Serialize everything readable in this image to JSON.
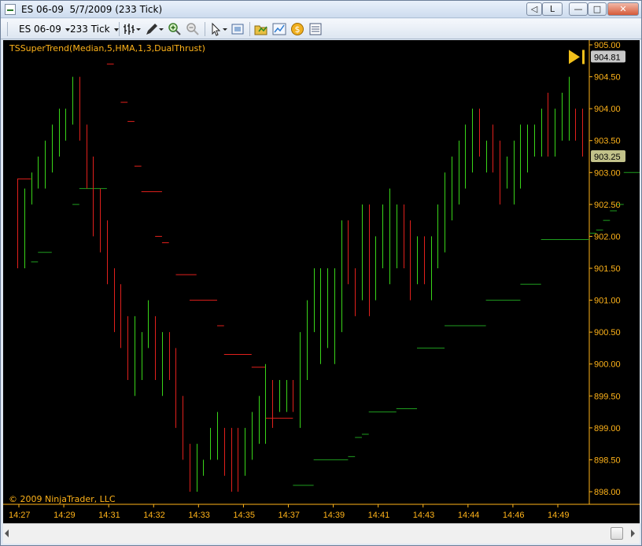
{
  "window": {
    "title": "ES 06-09  5/7/2009 (233 Tick)",
    "controls": {
      "link_label": "L",
      "minimize": "—",
      "maximize": "□",
      "close": "✕"
    }
  },
  "toolbar": {
    "instrument": "ES 06-09",
    "period": "233 Tick",
    "icons": [
      "bar-type-icon",
      "drawing-pen-icon",
      "zoom-in-icon",
      "zoom-out-icon",
      "cursor-pointer-icon",
      "snapshot-icon",
      "instrument-folder-icon",
      "chart-indicators-icon",
      "strategy-coin-icon",
      "data-box-icon"
    ]
  },
  "chart": {
    "indicator_label": "TSSuperTrend(Median,5,HMA,1,3,DualThrust)",
    "copyright": "© 2009 NinjaTrader, LLC",
    "last_price": "904.81",
    "stop_price": "903.25",
    "colors": {
      "up": "#39d619",
      "down": "#e2201c",
      "supertrend": "#1f9e1f",
      "axis": "#ffb319",
      "background": "#000000"
    }
  },
  "chart_data": {
    "type": "ohlc",
    "yticks": [
      "905.00",
      "904.50",
      "904.00",
      "903.50",
      "903.00",
      "902.50",
      "902.00",
      "901.50",
      "901.00",
      "900.50",
      "900.00",
      "899.50",
      "899.00",
      "898.50",
      "898.00"
    ],
    "ylim": [
      898.0,
      905.0
    ],
    "xticks": [
      "14:27",
      "14:29",
      "14:31",
      "14:32",
      "14:33",
      "14:35",
      "14:37",
      "14:39",
      "14:41",
      "14:43",
      "14:44",
      "14:46",
      "14:49"
    ],
    "bars": [
      {
        "dir": "down",
        "h": 902.9,
        "l": 901.5
      },
      {
        "dir": "up",
        "h": 902.75,
        "l": 901.5
      },
      {
        "dir": "up",
        "h": 903.0,
        "l": 902.5
      },
      {
        "dir": "up",
        "h": 903.25,
        "l": 902.75
      },
      {
        "dir": "up",
        "h": 903.5,
        "l": 902.75
      },
      {
        "dir": "up",
        "h": 903.75,
        "l": 903.0
      },
      {
        "dir": "up",
        "h": 904.0,
        "l": 903.25
      },
      {
        "dir": "up",
        "h": 904.0,
        "l": 903.5
      },
      {
        "dir": "up",
        "h": 904.5,
        "l": 903.75
      },
      {
        "dir": "down",
        "h": 904.5,
        "l": 903.5
      },
      {
        "dir": "down",
        "h": 903.75,
        "l": 902.75
      },
      {
        "dir": "down",
        "h": 903.25,
        "l": 902.0
      },
      {
        "dir": "down",
        "h": 902.75,
        "l": 901.75
      },
      {
        "dir": "down",
        "h": 902.25,
        "l": 901.25
      },
      {
        "dir": "down",
        "h": 901.5,
        "l": 900.5
      },
      {
        "dir": "down",
        "h": 901.25,
        "l": 900.25
      },
      {
        "dir": "down",
        "h": 900.75,
        "l": 899.75
      },
      {
        "dir": "up",
        "h": 900.75,
        "l": 899.5
      },
      {
        "dir": "up",
        "h": 900.5,
        "l": 899.75
      },
      {
        "dir": "up",
        "h": 901.0,
        "l": 900.25
      },
      {
        "dir": "down",
        "h": 900.75,
        "l": 899.75
      },
      {
        "dir": "up",
        "h": 900.5,
        "l": 899.5
      },
      {
        "dir": "down",
        "h": 900.5,
        "l": 899.75
      },
      {
        "dir": "down",
        "h": 900.25,
        "l": 899.0
      },
      {
        "dir": "down",
        "h": 899.5,
        "l": 898.5
      },
      {
        "dir": "down",
        "h": 898.75,
        "l": 898.0
      },
      {
        "dir": "up",
        "h": 898.75,
        "l": 898.0
      },
      {
        "dir": "up",
        "h": 898.5,
        "l": 898.25
      },
      {
        "dir": "up",
        "h": 899.0,
        "l": 898.5
      },
      {
        "dir": "up",
        "h": 899.25,
        "l": 898.5
      },
      {
        "dir": "down",
        "h": 899.0,
        "l": 898.25
      },
      {
        "dir": "down",
        "h": 899.0,
        "l": 898.0
      },
      {
        "dir": "down",
        "h": 899.0,
        "l": 898.0
      },
      {
        "dir": "up",
        "h": 899.0,
        "l": 898.25
      },
      {
        "dir": "up",
        "h": 899.25,
        "l": 898.5
      },
      {
        "dir": "up",
        "h": 899.5,
        "l": 898.75
      },
      {
        "dir": "up",
        "h": 900.0,
        "l": 898.75
      },
      {
        "dir": "down",
        "h": 899.75,
        "l": 899.0
      },
      {
        "dir": "up",
        "h": 899.75,
        "l": 899.25
      },
      {
        "dir": "up",
        "h": 899.75,
        "l": 899.25
      },
      {
        "dir": "down",
        "h": 899.75,
        "l": 899.25
      },
      {
        "dir": "up",
        "h": 900.5,
        "l": 899.0
      },
      {
        "dir": "up",
        "h": 901.0,
        "l": 899.75
      },
      {
        "dir": "up",
        "h": 901.5,
        "l": 900.5
      },
      {
        "dir": "up",
        "h": 901.5,
        "l": 900.0
      },
      {
        "dir": "up",
        "h": 901.5,
        "l": 900.25
      },
      {
        "dir": "up",
        "h": 901.5,
        "l": 900.0
      },
      {
        "dir": "up",
        "h": 902.25,
        "l": 900.5
      },
      {
        "dir": "down",
        "h": 902.25,
        "l": 901.25
      },
      {
        "dir": "down",
        "h": 901.5,
        "l": 900.75
      },
      {
        "dir": "up",
        "h": 902.5,
        "l": 901.0
      },
      {
        "dir": "down",
        "h": 902.5,
        "l": 900.75
      },
      {
        "dir": "up",
        "h": 902.0,
        "l": 901.0
      },
      {
        "dir": "up",
        "h": 902.5,
        "l": 901.5
      },
      {
        "dir": "up",
        "h": 902.75,
        "l": 901.25
      },
      {
        "dir": "up",
        "h": 902.5,
        "l": 901.5
      },
      {
        "dir": "down",
        "h": 902.5,
        "l": 901.5
      },
      {
        "dir": "down",
        "h": 902.25,
        "l": 901.0
      },
      {
        "dir": "up",
        "h": 902.0,
        "l": 901.25
      },
      {
        "dir": "down",
        "h": 902.0,
        "l": 901.25
      },
      {
        "dir": "up",
        "h": 902.0,
        "l": 901.0
      },
      {
        "dir": "up",
        "h": 902.5,
        "l": 901.5
      },
      {
        "dir": "up",
        "h": 903.0,
        "l": 901.75
      },
      {
        "dir": "up",
        "h": 903.25,
        "l": 902.25
      },
      {
        "dir": "up",
        "h": 903.5,
        "l": 902.5
      },
      {
        "dir": "up",
        "h": 903.75,
        "l": 902.75
      },
      {
        "dir": "up",
        "h": 904.0,
        "l": 903.0
      },
      {
        "dir": "down",
        "h": 904.0,
        "l": 903.25
      },
      {
        "dir": "up",
        "h": 903.5,
        "l": 903.0
      },
      {
        "dir": "down",
        "h": 903.75,
        "l": 903.0
      },
      {
        "dir": "down",
        "h": 903.5,
        "l": 902.5
      },
      {
        "dir": "up",
        "h": 903.25,
        "l": 902.75
      },
      {
        "dir": "up",
        "h": 903.5,
        "l": 902.5
      },
      {
        "dir": "up",
        "h": 903.75,
        "l": 902.75
      },
      {
        "dir": "up",
        "h": 903.75,
        "l": 903.0
      },
      {
        "dir": "up",
        "h": 903.75,
        "l": 903.25
      },
      {
        "dir": "up",
        "h": 904.0,
        "l": 903.25
      },
      {
        "dir": "down",
        "h": 904.25,
        "l": 903.25
      },
      {
        "dir": "up",
        "h": 904.0,
        "l": 903.25
      },
      {
        "dir": "up",
        "h": 904.25,
        "l": 903.5
      },
      {
        "dir": "up",
        "h": 904.5,
        "l": 903.5
      },
      {
        "dir": "down",
        "h": 904.0,
        "l": 903.5
      },
      {
        "dir": "down",
        "h": 904.0,
        "l": 903.25
      }
    ],
    "supertrend": [
      {
        "from": 0,
        "to": 2,
        "price": 902.9,
        "dir": "down"
      },
      {
        "from": 2,
        "to": 3,
        "price": 901.6,
        "dir": "up"
      },
      {
        "from": 3,
        "to": 5,
        "price": 901.75,
        "dir": "up"
      },
      {
        "from": 8,
        "to": 9,
        "price": 902.5,
        "dir": "up"
      },
      {
        "from": 9,
        "to": 13,
        "price": 902.75,
        "dir": "up"
      },
      {
        "from": 13,
        "to": 14,
        "price": 904.7,
        "dir": "down"
      },
      {
        "from": 15,
        "to": 16,
        "price": 904.1,
        "dir": "down"
      },
      {
        "from": 16,
        "to": 17,
        "price": 903.8,
        "dir": "down"
      },
      {
        "from": 17,
        "to": 18,
        "price": 903.1,
        "dir": "down"
      },
      {
        "from": 18,
        "to": 21,
        "price": 902.7,
        "dir": "down"
      },
      {
        "from": 20,
        "to": 21,
        "price": 902.0,
        "dir": "down"
      },
      {
        "from": 21,
        "to": 22,
        "price": 901.9,
        "dir": "down"
      },
      {
        "from": 23,
        "to": 26,
        "price": 901.4,
        "dir": "down"
      },
      {
        "from": 25,
        "to": 29,
        "price": 901.0,
        "dir": "down"
      },
      {
        "from": 29,
        "to": 30,
        "price": 900.6,
        "dir": "down"
      },
      {
        "from": 30,
        "to": 34,
        "price": 900.15,
        "dir": "down"
      },
      {
        "from": 34,
        "to": 36,
        "price": 899.95,
        "dir": "down"
      },
      {
        "from": 36,
        "to": 40,
        "price": 899.15,
        "dir": "down"
      },
      {
        "from": 40,
        "to": 43,
        "price": 898.1,
        "dir": "up"
      },
      {
        "from": 43,
        "to": 48,
        "price": 898.5,
        "dir": "up"
      },
      {
        "from": 48,
        "to": 49,
        "price": 898.55,
        "dir": "up"
      },
      {
        "from": 49,
        "to": 50,
        "price": 898.85,
        "dir": "up"
      },
      {
        "from": 50,
        "to": 51,
        "price": 898.9,
        "dir": "up"
      },
      {
        "from": 51,
        "to": 55,
        "price": 899.25,
        "dir": "up"
      },
      {
        "from": 55,
        "to": 58,
        "price": 899.3,
        "dir": "up"
      },
      {
        "from": 58,
        "to": 62,
        "price": 900.25,
        "dir": "up"
      },
      {
        "from": 62,
        "to": 68,
        "price": 900.6,
        "dir": "up"
      },
      {
        "from": 68,
        "to": 73,
        "price": 901.0,
        "dir": "up"
      },
      {
        "from": 73,
        "to": 76,
        "price": 901.25,
        "dir": "up"
      },
      {
        "from": 76,
        "to": 83,
        "price": 901.95,
        "dir": "up"
      },
      {
        "from": 83,
        "to": 84,
        "price": 902.05,
        "dir": "up"
      },
      {
        "from": 84,
        "to": 85,
        "price": 902.1,
        "dir": "up"
      },
      {
        "from": 85,
        "to": 86,
        "price": 902.25,
        "dir": "up"
      },
      {
        "from": 86,
        "to": 87,
        "price": 902.4,
        "dir": "up"
      },
      {
        "from": 87,
        "to": 88,
        "price": 902.5,
        "dir": "up"
      },
      {
        "from": 88,
        "to": 92,
        "price": 903.0,
        "dir": "up"
      },
      {
        "from": 92,
        "to": 94,
        "price": 903.5,
        "dir": "up"
      }
    ]
  }
}
